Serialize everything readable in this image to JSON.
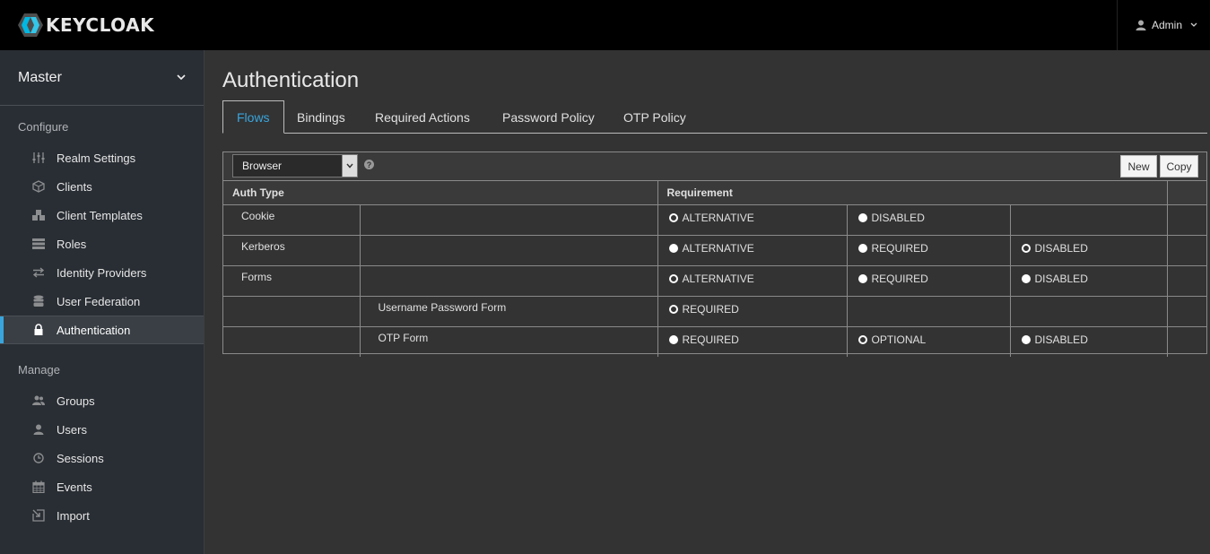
{
  "header": {
    "logo_text": "KEYCLOAK",
    "user_label": "Admin",
    "user_icon": "user-icon",
    "chevron_icon": "chevron-down-icon"
  },
  "sidebar": {
    "realm": "Master",
    "configure_heading": "Configure",
    "manage_heading": "Manage",
    "configure_items": [
      {
        "label": "Realm Settings",
        "icon": "sliders-icon"
      },
      {
        "label": "Clients",
        "icon": "cube-icon"
      },
      {
        "label": "Client Templates",
        "icon": "cubes-icon"
      },
      {
        "label": "Roles",
        "icon": "list-icon"
      },
      {
        "label": "Identity Providers",
        "icon": "exchange-icon"
      },
      {
        "label": "User Federation",
        "icon": "database-icon"
      },
      {
        "label": "Authentication",
        "icon": "lock-icon"
      }
    ],
    "manage_items": [
      {
        "label": "Groups",
        "icon": "users-icon"
      },
      {
        "label": "Users",
        "icon": "user-icon"
      },
      {
        "label": "Sessions",
        "icon": "clock-icon"
      },
      {
        "label": "Events",
        "icon": "calendar-icon"
      },
      {
        "label": "Import",
        "icon": "import-icon"
      }
    ],
    "active": "Authentication"
  },
  "main": {
    "title": "Authentication",
    "tabs": [
      "Flows",
      "Bindings",
      "Required Actions",
      "Password Policy",
      "OTP Policy"
    ],
    "active_tab": "Flows",
    "flow_select": "Browser",
    "buttons": {
      "new": "New",
      "copy": "Copy"
    },
    "columns": {
      "auth_type": "Auth Type",
      "requirement": "Requirement"
    },
    "rows": [
      {
        "name": "Cookie",
        "level": 0,
        "options": [
          {
            "label": "ALTERNATIVE",
            "checked": true
          },
          {
            "label": "DISABLED",
            "checked": false
          }
        ]
      },
      {
        "name": "Kerberos",
        "level": 0,
        "options": [
          {
            "label": "ALTERNATIVE",
            "checked": false
          },
          {
            "label": "REQUIRED",
            "checked": false
          },
          {
            "label": "DISABLED",
            "checked": true
          }
        ]
      },
      {
        "name": "Forms",
        "level": 0,
        "options": [
          {
            "label": "ALTERNATIVE",
            "checked": true
          },
          {
            "label": "REQUIRED",
            "checked": false
          },
          {
            "label": "DISABLED",
            "checked": false
          }
        ]
      },
      {
        "name": "Username Password Form",
        "level": 1,
        "options": [
          {
            "label": "REQUIRED",
            "checked": true
          }
        ]
      },
      {
        "name": "OTP Form",
        "level": 1,
        "options": [
          {
            "label": "REQUIRED",
            "checked": false
          },
          {
            "label": "OPTIONAL",
            "checked": true
          },
          {
            "label": "DISABLED",
            "checked": false
          }
        ]
      }
    ]
  },
  "colors": {
    "accent": "#39a5dc",
    "sidebar_bg": "#292e34",
    "main_bg": "#333333",
    "topbar_bg": "#000000"
  }
}
